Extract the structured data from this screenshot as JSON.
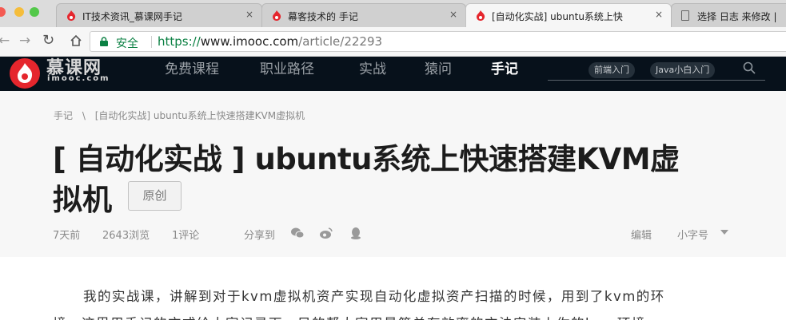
{
  "browser": {
    "tabs": [
      {
        "title": "IT技术资讯_慕课网手记",
        "close": "×",
        "active": false
      },
      {
        "title": "幕客技术的 手记",
        "close": "×",
        "active": false
      },
      {
        "title": "[自动化实战] ubuntu系统上快",
        "close": "×",
        "active": true
      },
      {
        "title": "选择 日志 来修改 |",
        "close": "",
        "active": false
      }
    ],
    "security_label": "安全",
    "url_scheme": "https://",
    "url_host": "www.imooc.com",
    "url_path": "/article/22293"
  },
  "site": {
    "logo_name": "慕课网",
    "logo_sub": "imooc.com",
    "nav": [
      "免费课程",
      "职业路径",
      "实战",
      "猿问",
      "手记"
    ],
    "active_nav": "手记",
    "search_tags": [
      "前端入门",
      "Java小白入门"
    ],
    "accent_color": "#e5262d",
    "header_bg": "#07111b"
  },
  "article": {
    "breadcrumb": [
      "手记",
      "\\",
      "[自动化实战] ubuntu系统上快速搭建KVM虚拟机"
    ],
    "title_line1": "[ 自动化实战 ] ubuntu系统上快速搭建KVM虚",
    "title_line2": "拟机",
    "badge": "原创",
    "time_ago": "7天前",
    "views": "2643浏览",
    "comments": "1评论",
    "share_label": "分享到",
    "share_icons": [
      "wechat-icon",
      "weibo-icon",
      "qq-icon"
    ],
    "edit_label": "编辑",
    "font_size_label": "小字号",
    "body_line1": "我的实战课，讲解到对于kvm虚拟机资产实现自动化虚拟资产扫描的时候，用到了kvm的环",
    "body_line2": "境，这里用手记的方式给大家记录下，目的帮大家用最简单有效率的方法安装上你的kvm环境。"
  }
}
